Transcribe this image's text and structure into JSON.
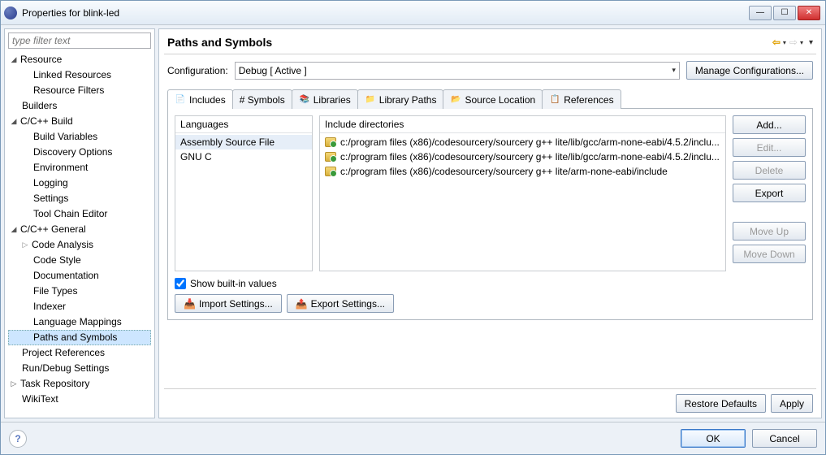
{
  "window_title": "Properties for blink-led",
  "filter_placeholder": "type filter text",
  "tree": {
    "resource": "Resource",
    "linked_resources": "Linked Resources",
    "resource_filters": "Resource Filters",
    "builders": "Builders",
    "ccpp_build": "C/C++ Build",
    "build_variables": "Build Variables",
    "discovery_options": "Discovery Options",
    "environment": "Environment",
    "logging": "Logging",
    "settings": "Settings",
    "tool_chain_editor": "Tool Chain Editor",
    "ccpp_general": "C/C++ General",
    "code_analysis": "Code Analysis",
    "code_style": "Code Style",
    "documentation": "Documentation",
    "file_types": "File Types",
    "indexer": "Indexer",
    "language_mappings": "Language Mappings",
    "paths_symbols": "Paths and Symbols",
    "project_references": "Project References",
    "run_debug_settings": "Run/Debug Settings",
    "task_repository": "Task Repository",
    "wikitext": "WikiText"
  },
  "page_title": "Paths and Symbols",
  "config_label": "Configuration:",
  "config_value": "Debug  [ Active ]",
  "manage_config": "Manage Configurations...",
  "tabs": {
    "includes": "Includes",
    "symbols": "# Symbols",
    "libraries": "Libraries",
    "library_paths": "Library Paths",
    "source_location": "Source Location",
    "references": "References"
  },
  "languages_header": "Languages",
  "languages": [
    "Assembly Source File",
    "GNU C"
  ],
  "include_header": "Include directories",
  "includes": [
    "c:/program files (x86)/codesourcery/sourcery g++ lite/lib/gcc/arm-none-eabi/4.5.2/inclu...",
    "c:/program files (x86)/codesourcery/sourcery g++ lite/lib/gcc/arm-none-eabi/4.5.2/inclu...",
    "c:/program files (x86)/codesourcery/sourcery g++ lite/arm-none-eabi/include"
  ],
  "side_buttons": {
    "add": "Add...",
    "edit": "Edit...",
    "delete": "Delete",
    "export": "Export",
    "move_up": "Move Up",
    "move_down": "Move Down"
  },
  "show_builtin": "Show built-in values",
  "import_settings": "Import Settings...",
  "export_settings": "Export Settings...",
  "restore_defaults": "Restore Defaults",
  "apply": "Apply",
  "ok": "OK",
  "cancel": "Cancel"
}
